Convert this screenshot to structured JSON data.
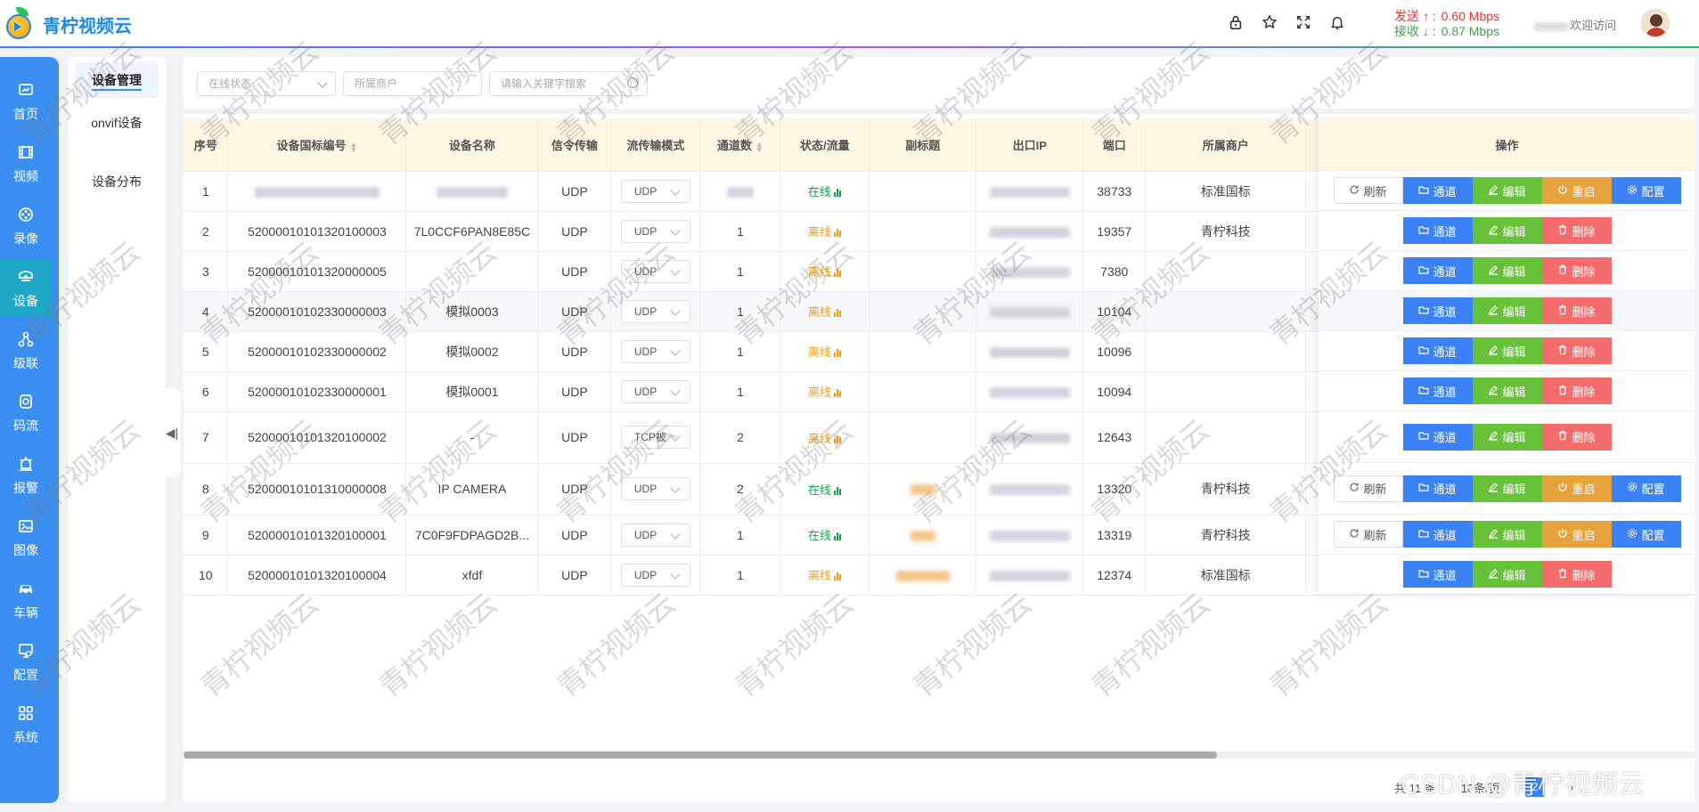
{
  "app": {
    "title": "青柠视频云"
  },
  "header": {
    "speed": {
      "send_label": "发送 ↑ :",
      "send_value": "0.60 Mbps",
      "recv_label": "接收 ↓ :",
      "recv_value": "0.87 Mbps"
    },
    "user_suffix": "欢迎访问"
  },
  "nav": [
    {
      "label": "首页",
      "icon": "dashboard-icon"
    },
    {
      "label": "视频",
      "icon": "video-icon"
    },
    {
      "label": "录像",
      "icon": "reel-icon"
    },
    {
      "label": "设备",
      "icon": "camera-icon",
      "active": true
    },
    {
      "label": "级联",
      "icon": "cascade-icon"
    },
    {
      "label": "码流",
      "icon": "stream-icon"
    },
    {
      "label": "报警",
      "icon": "alarm-icon"
    },
    {
      "label": "图像",
      "icon": "image-icon"
    },
    {
      "label": "车辆",
      "icon": "car-icon"
    },
    {
      "label": "配置",
      "icon": "config-icon"
    },
    {
      "label": "系统",
      "icon": "grid-icon"
    }
  ],
  "subnav": {
    "device_manage": "设备管理",
    "onvif": "onvif设备",
    "distribution": "设备分布"
  },
  "filters": {
    "status_placeholder": "在线状态",
    "merchant_placeholder": "所属商户",
    "keyword_placeholder": "请输入关键字搜索"
  },
  "table": {
    "headers": {
      "index": "序号",
      "gb_id": "设备国标编号",
      "name": "设备名称",
      "signal": "信令传输",
      "stream_mode": "流传输模式",
      "channels": "通道数",
      "status": "状态/流量",
      "subtitle": "副标题",
      "egress_ip": "出口IP",
      "port": "端口",
      "merchant": "所属商户",
      "ops": "操作"
    },
    "rows": [
      {
        "index": "1",
        "gb_id": "",
        "name": "",
        "signal": "UDP",
        "mode": "UDP",
        "channels": "",
        "status": "在线",
        "online": true,
        "port": "38733",
        "merchant": "标准国标"
      },
      {
        "index": "2",
        "gb_id": "52000010101320100003",
        "name": "7L0CCF6PAN8E85C",
        "signal": "UDP",
        "mode": "UDP",
        "channels": "1",
        "status": "离线",
        "online": false,
        "port": "19357",
        "merchant": "青柠科技"
      },
      {
        "index": "3",
        "gb_id": "52000010101320000005",
        "name": "",
        "signal": "UDP",
        "mode": "UDP",
        "channels": "1",
        "status": "离线",
        "online": false,
        "port": "7380",
        "merchant": ""
      },
      {
        "index": "4",
        "gb_id": "52000010102330000003",
        "name": "模拟0003",
        "signal": "UDP",
        "mode": "UDP",
        "channels": "1",
        "status": "离线",
        "online": false,
        "port": "10104",
        "merchant": ""
      },
      {
        "index": "5",
        "gb_id": "52000010102330000002",
        "name": "模拟0002",
        "signal": "UDP",
        "mode": "UDP",
        "channels": "1",
        "status": "离线",
        "online": false,
        "port": "10096",
        "merchant": ""
      },
      {
        "index": "6",
        "gb_id": "52000010102330000001",
        "name": "模拟0001",
        "signal": "UDP",
        "mode": "UDP",
        "channels": "1",
        "status": "离线",
        "online": false,
        "port": "10094",
        "merchant": ""
      },
      {
        "index": "7",
        "gb_id": "52000010101320100002",
        "name": "-",
        "signal": "UDP",
        "mode": "TCP被",
        "channels": "2",
        "status": "离线",
        "online": false,
        "port": "12643",
        "merchant": ""
      },
      {
        "index": "8",
        "gb_id": "52000010101310000008",
        "name": "IP CAMERA",
        "signal": "UDP",
        "mode": "UDP",
        "channels": "2",
        "status": "在线",
        "online": true,
        "port": "13320",
        "merchant": "青柠科技"
      },
      {
        "index": "9",
        "gb_id": "52000010101320100001",
        "name": "7C0F9FDPAGD2B...",
        "signal": "UDP",
        "mode": "UDP",
        "channels": "1",
        "status": "在线",
        "online": true,
        "port": "13319",
        "merchant": "青柠科技"
      },
      {
        "index": "10",
        "gb_id": "52000010101320100004",
        "name": "xfdf",
        "signal": "UDP",
        "mode": "UDP",
        "channels": "1",
        "status": "离线",
        "online": false,
        "port": "12374",
        "merchant": "标准国标"
      }
    ]
  },
  "ops": {
    "refresh": "刷新",
    "channel": "通道",
    "edit": "编辑",
    "restart": "重启",
    "delete": "删除",
    "config": "配置"
  },
  "pagination": {
    "total": "共 11 条",
    "page_size": "10条/页",
    "current": "2"
  },
  "watermark": {
    "text": "青柠视频云",
    "footer": "CSDN @青柠视频云"
  },
  "colors": {
    "primary": "#3b82f6",
    "nav_bg": "#3b8ff0",
    "nav_active": "#1fa7c7",
    "success": "#67c23a",
    "warning": "#e6a23c",
    "danger": "#f56c6c",
    "online": "#16a34a",
    "offline": "#f59e0b"
  }
}
